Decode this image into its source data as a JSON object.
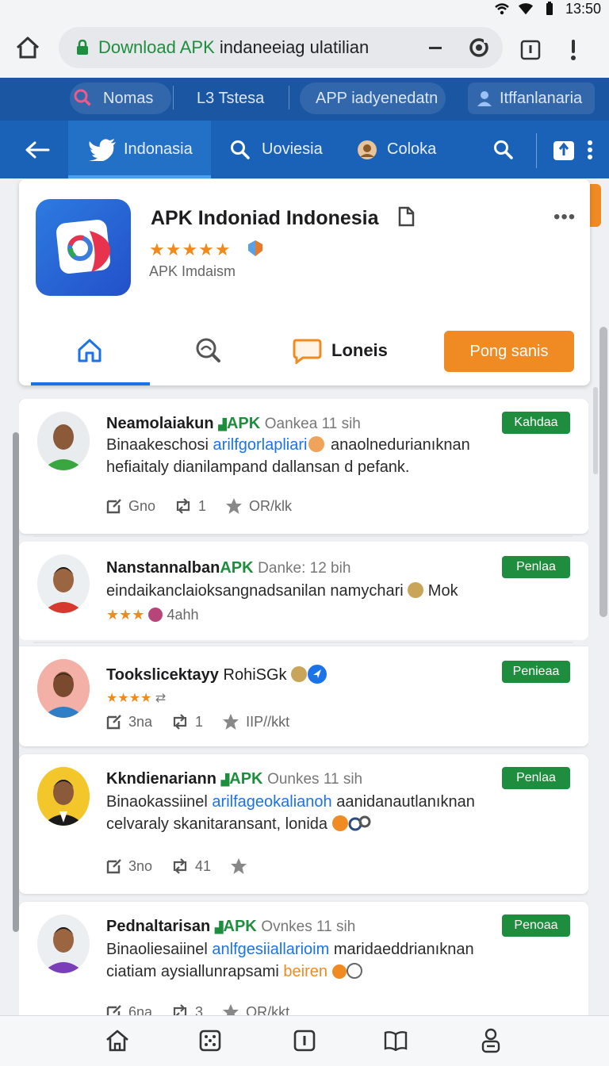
{
  "status": {
    "time": "13:50"
  },
  "browser": {
    "url_highlight": "Download APK",
    "url_rest": " indaneeiag ulatilian"
  },
  "top_chips": [
    {
      "label": "Nomas"
    },
    {
      "label": "L3 Tstesa"
    },
    {
      "label": "APP iadyenedatn"
    },
    {
      "label": "Itffanlanaria"
    }
  ],
  "app_nav": {
    "tabs": [
      {
        "label": "Indonasia",
        "icon": "twitter-bird-icon"
      },
      {
        "label": "Uoviesia",
        "icon": "search-icon"
      },
      {
        "label": "Coloka",
        "icon": "avatar-icon"
      }
    ]
  },
  "app": {
    "title": "APK Indoniad Indonesia",
    "subtitle": "APK Imdaism",
    "rating_stars": 4.5,
    "stars_text": "★★★★★",
    "tab_label": "Loneis",
    "install_label": "Pong sanis",
    "colors": {
      "accent": "#ef8b22",
      "brand": "#1a62b8"
    }
  },
  "posts": [
    {
      "name": "Neamolaiakun",
      "tag": "APK",
      "meta": "Oankea 11 sih",
      "badge": "Kahdaa",
      "line1a": "Binaakeschosi ",
      "line1_link": "arilfgorlapliari",
      "line1b": " anaolnedurianıknan",
      "line2": "hefiaitaly dianilampand dallansan d pefank.",
      "a1": "Gno",
      "a2": "1",
      "a3": "OR/klk"
    },
    {
      "name": "Nanstannalban",
      "tag": "APK",
      "meta": "Danke: 12 bih",
      "badge": "Penlaa",
      "line1a": "eindaikanclaioksangnadsanilan namychari",
      "line1_link": "",
      "line1b": " Mok",
      "line2": "4ahh",
      "stars": "★★★"
    },
    {
      "name": "Tookslicektayy",
      "tag": "",
      "meta": "RohiSGk",
      "badge": "Penieaa",
      "stars": "★★★★",
      "a1": "3na",
      "a2": "1",
      "a3": "IIP//kkt"
    },
    {
      "name": "Kkndienariann",
      "tag": "APK",
      "meta": "Ounkes 11 sih",
      "badge": "Penlaa",
      "line1a": "Binaokassiinel ",
      "line1_link": "arilfagеokalianoh",
      "line1b": " aanidanautlanıknan",
      "line2": "celvaraly skanitaransant, lonida",
      "a1": "3no",
      "a2": "41",
      "a3": ""
    },
    {
      "name": "Pednaltarisan",
      "tag": "APK",
      "meta": "Ovnkes 11 sih",
      "badge": "Penoaa",
      "line1a": "Binaoliesaiinel ",
      "line1_link": "anlfgesiiallarioim",
      "line1b": " maridaeddrianıknan",
      "line2": "ciatiam aysiallunrapsami ",
      "line2_orange": "beiren",
      "a1": "6na",
      "a2": "3",
      "a3": "OR/kkt"
    }
  ]
}
